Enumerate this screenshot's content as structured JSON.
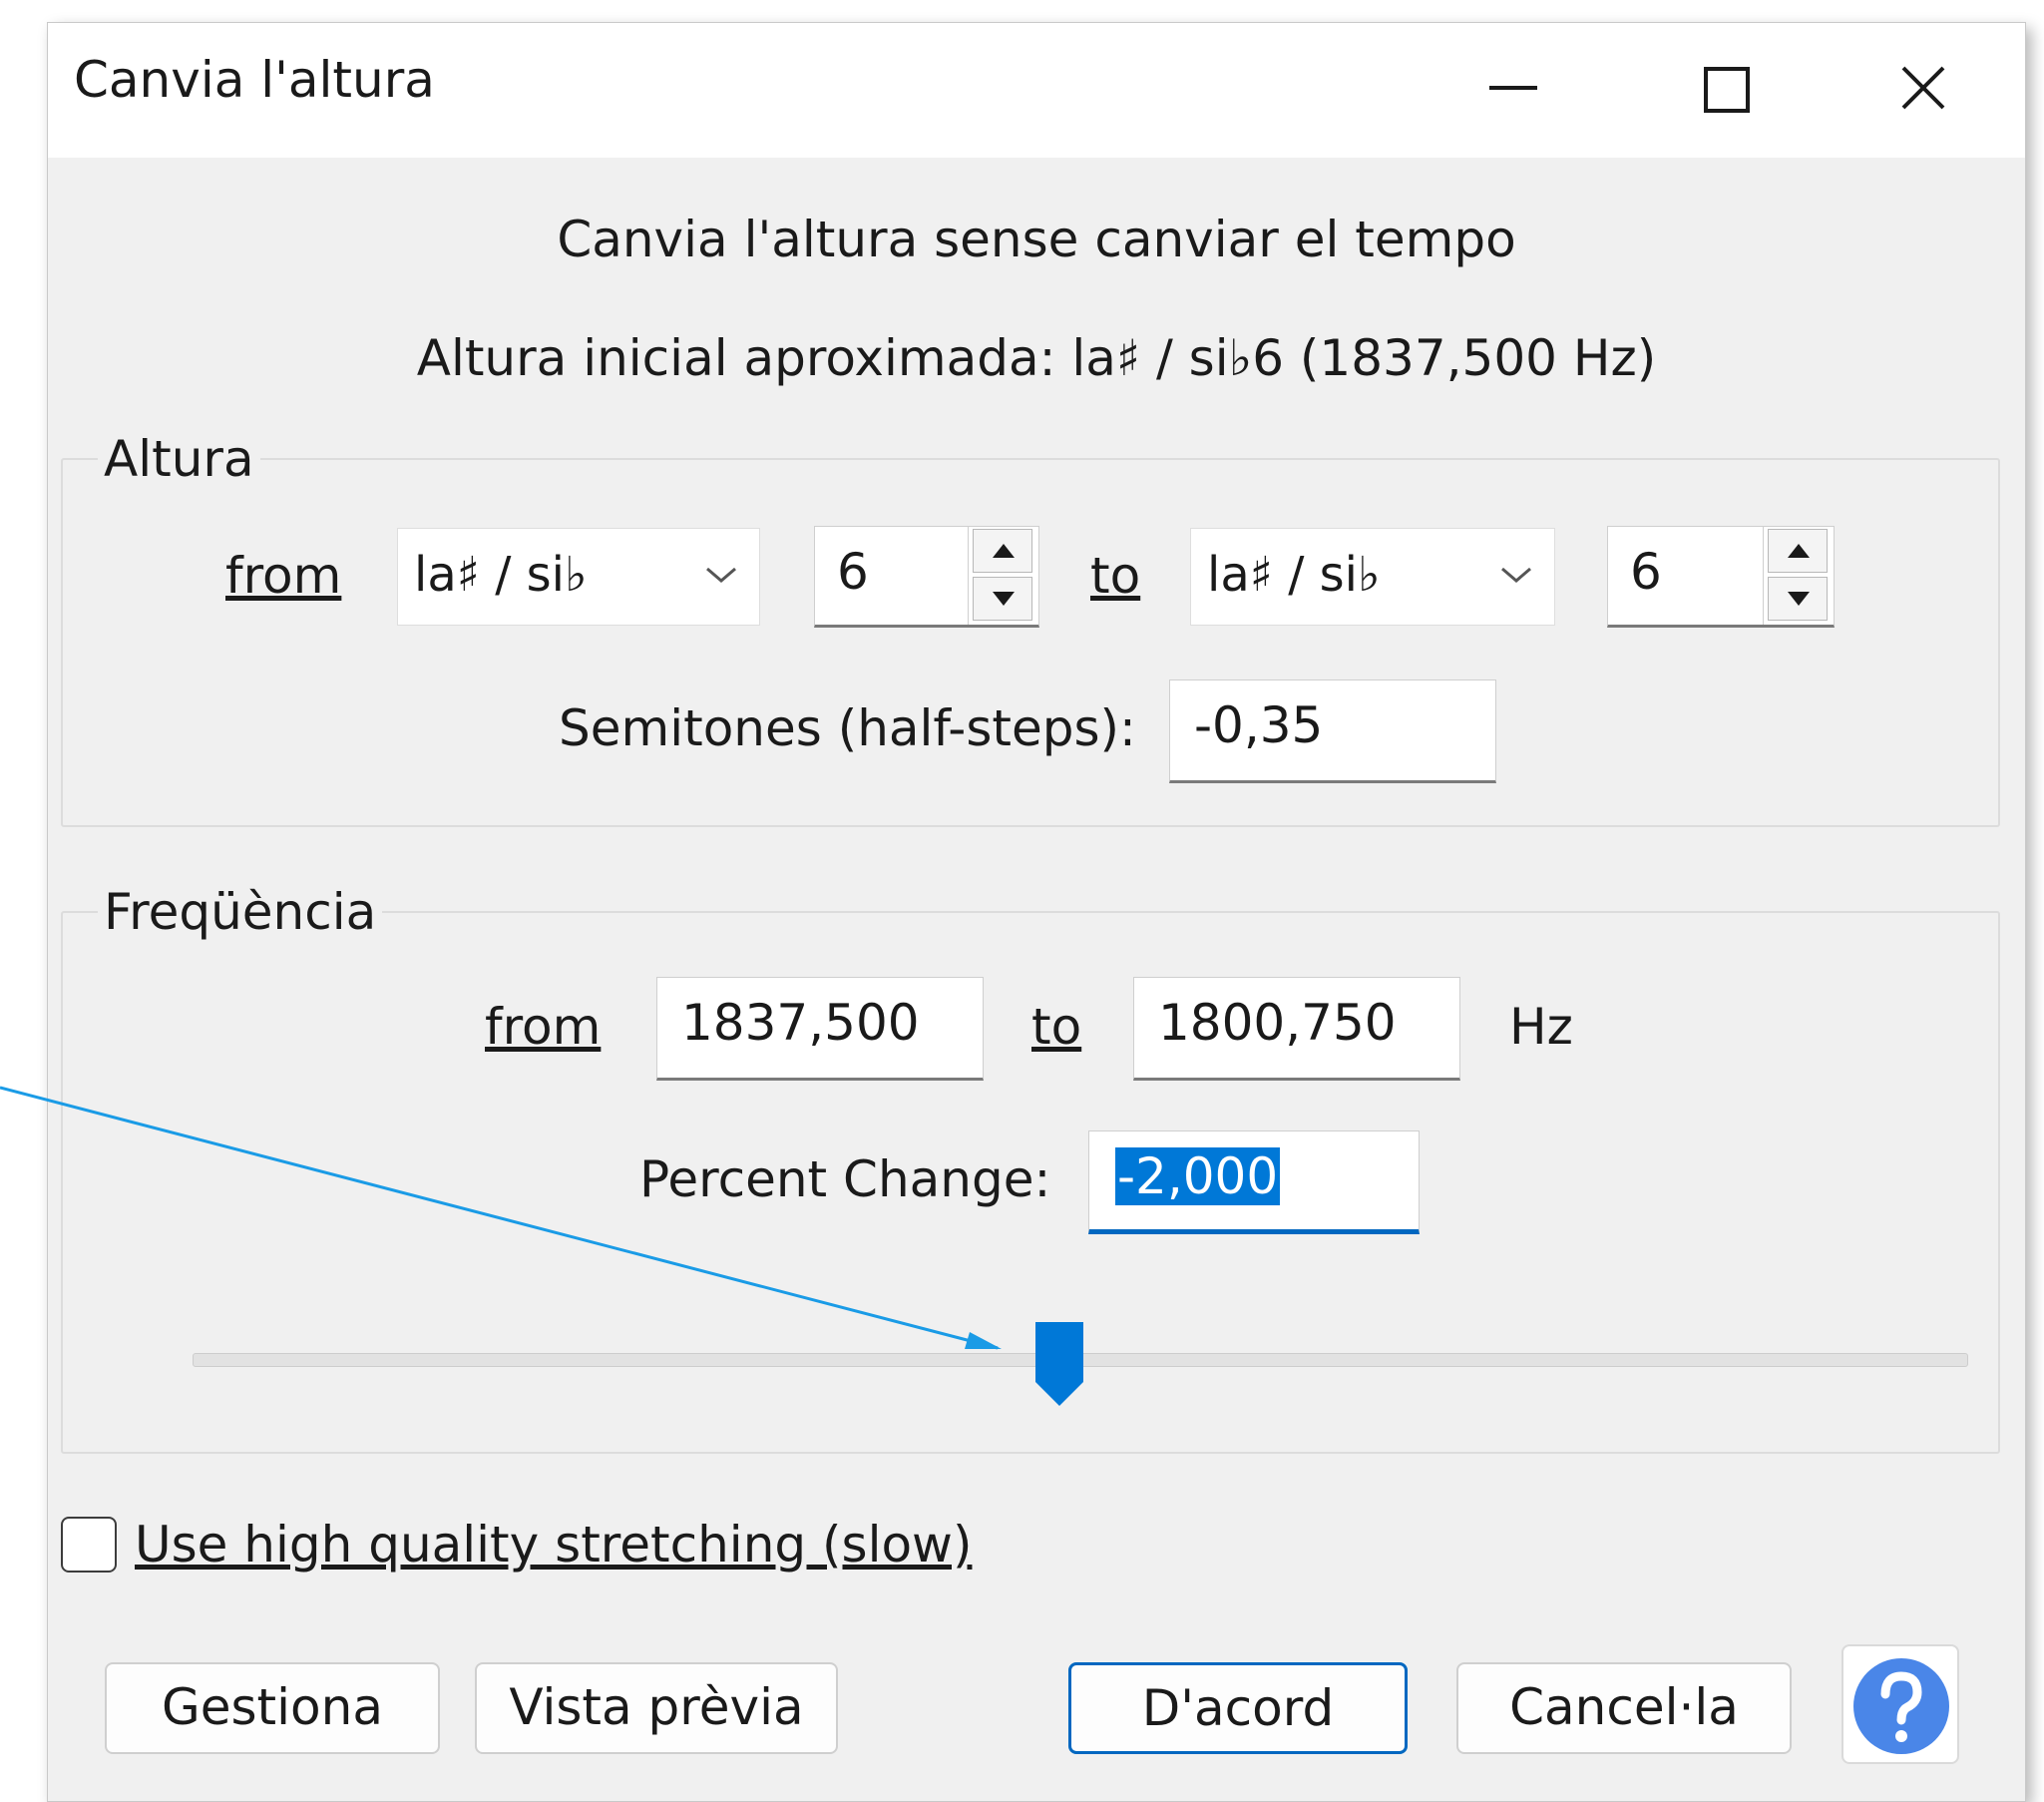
{
  "window": {
    "title": "Canvia l'altura",
    "minimize_icon": "minimize-icon",
    "maximize_icon": "maximize-icon",
    "close_icon": "close-icon"
  },
  "header": {
    "line1": "Canvia l'altura sense canviar el tempo",
    "line2": "Altura inicial aproximada: la♯ / si♭6 (1837,500 Hz)"
  },
  "pitch": {
    "group_label": "Altura",
    "from_label": "from",
    "from_note": "la♯ / si♭",
    "from_octave": "6",
    "to_label": "to",
    "to_note": "la♯ / si♭",
    "to_octave": "6",
    "semitones_label": "Semitones (half-steps):",
    "semitones_value": "-0,35"
  },
  "frequency": {
    "group_label": "Freqüència",
    "from_label": "from",
    "from_value": "1837,500",
    "to_label": "to",
    "to_value": "1800,750",
    "unit": "Hz",
    "percent_label": "Percent Change:",
    "percent_value": "-2,000",
    "slider_level": 0.49
  },
  "options": {
    "high_quality_label": "Use high quality stretching (slow)",
    "high_quality_checked": false
  },
  "buttons": {
    "manage": "Gestiona",
    "preview": "Vista prèvia",
    "ok": "D'acord",
    "cancel": "Cancel·la",
    "help_icon": "help-icon"
  },
  "colors": {
    "accent": "#0078d7",
    "annotation_line": "#1a9be6",
    "help": "#4a86e8"
  }
}
